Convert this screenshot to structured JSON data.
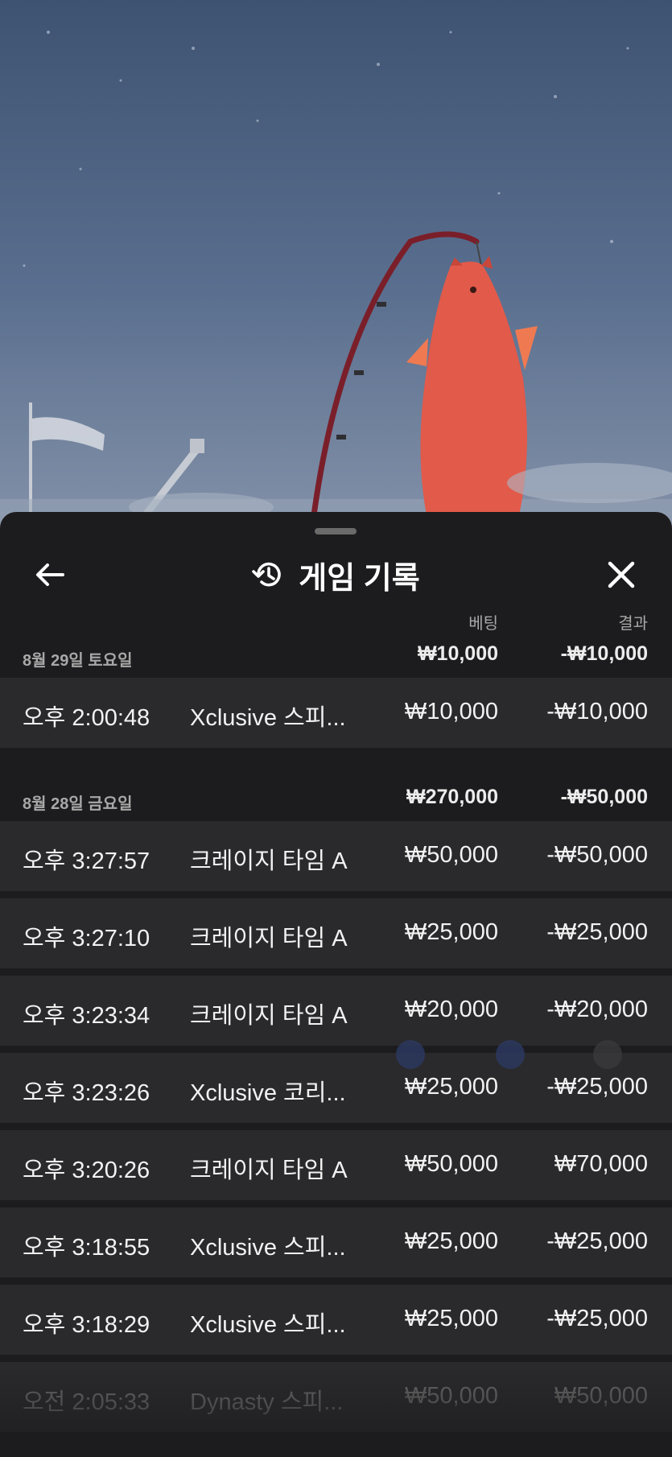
{
  "header": {
    "title": "게임 기록",
    "back_icon": "arrow-left-icon",
    "history_icon": "history-icon",
    "close_icon": "close-icon"
  },
  "columns": {
    "bet": "베팅",
    "result": "결과"
  },
  "groups": [
    {
      "date": "8월 29일 토요일",
      "bet_total": "₩10,000",
      "result_total": "-₩10,000",
      "rows": [
        {
          "time": "오후 2:00:48",
          "game": "Xclusive 스피...",
          "bet": "₩10,000",
          "result": "-₩10,000"
        }
      ]
    },
    {
      "date": "8월 28일 금요일",
      "bet_total": "₩270,000",
      "result_total": "-₩50,000",
      "rows": [
        {
          "time": "오후 3:27:57",
          "game": "크레이지 타임 A",
          "bet": "₩50,000",
          "result": "-₩50,000"
        },
        {
          "time": "오후 3:27:10",
          "game": "크레이지 타임 A",
          "bet": "₩25,000",
          "result": "-₩25,000"
        },
        {
          "time": "오후 3:23:34",
          "game": "크레이지 타임 A",
          "bet": "₩20,000",
          "result": "-₩20,000"
        },
        {
          "time": "오후 3:23:26",
          "game": "Xclusive 코리...",
          "bet": "₩25,000",
          "result": "-₩25,000"
        },
        {
          "time": "오후 3:20:26",
          "game": "크레이지 타임 A",
          "bet": "₩50,000",
          "result": "₩70,000"
        },
        {
          "time": "오후 3:18:55",
          "game": "Xclusive 스피...",
          "bet": "₩25,000",
          "result": "-₩25,000"
        },
        {
          "time": "오후 3:18:29",
          "game": "Xclusive 스피...",
          "bet": "₩25,000",
          "result": "-₩25,000"
        },
        {
          "time": "오전 2:05:33",
          "game": "Dynasty 스피...",
          "bet": "₩50,000",
          "result": "₩50,000"
        }
      ]
    }
  ],
  "colors": {
    "sheet": "#1c1c1e",
    "row": "#2a2a2c",
    "muted": "#a8a8a8",
    "text": "#f2f2f2"
  }
}
